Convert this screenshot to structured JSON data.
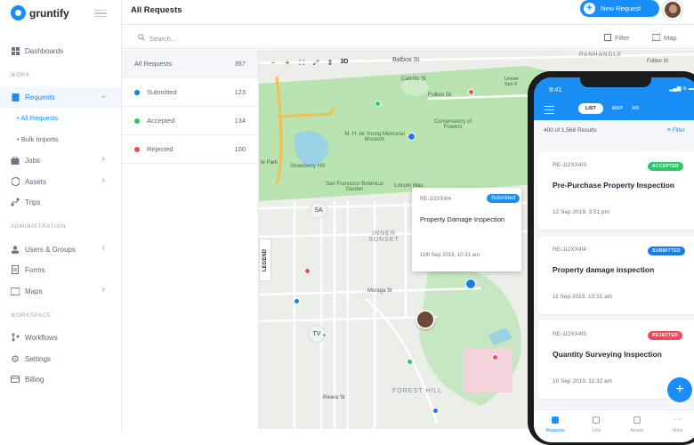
{
  "app": {
    "name": "gruntify",
    "page_title": "All Requests",
    "new_button": "New Request"
  },
  "sidebar": {
    "dashboards": "Dashboards",
    "section_work": "WORK",
    "requests": "Requests",
    "all_requests": "All Requests",
    "bulk_imports": "Bulk Imports",
    "jobs": "Jobs",
    "assets": "Assets",
    "trips": "Trips",
    "section_admin": "ADMINISTRATION",
    "users_groups": "Users & Groups",
    "forms": "Forms",
    "maps": "Maps",
    "section_workspace": "WORKSPACE",
    "workflows": "Workflows",
    "settings": "Settings",
    "billing": "Billing"
  },
  "toolbar": {
    "search_placeholder": "Search...",
    "filter": "Filter",
    "map": "Map"
  },
  "statuses": [
    {
      "label": "All Requests",
      "count": "357"
    },
    {
      "label": "Submitted",
      "count": "123",
      "color": "#1a7af0"
    },
    {
      "label": "Accepted",
      "count": "134",
      "color": "#2ec66b"
    },
    {
      "label": "Rejected",
      "count": "100",
      "color": "#ef4a5b"
    }
  ],
  "map": {
    "controls": [
      "−",
      "+",
      "⛶",
      "⤢",
      "⇕",
      "3D"
    ],
    "legend": "LEGEND",
    "clusters": [
      "SA",
      "TV"
    ],
    "labels": {
      "balboa": "Balboa St",
      "cabrillo": "Cabrillo St",
      "fulton": "Fulton St",
      "fulton_right": "Fulton St",
      "panhandle": "PANHANDLE",
      "conservatory": "Conservatory of Flowers",
      "deyoung": "M. H. de Young Memorial Museum",
      "strawberry": "Strawberry Hill",
      "botanical": "San Francisco Botanical Garden",
      "inner_sunset": "INNER SUNSET",
      "forest_hill": "FOREST HILL",
      "moraga": "Moraga St",
      "rivera": "Rivera St",
      "park": "te Park",
      "lincoln": "Lincoln Way",
      "univ": "Univer San F"
    },
    "popup": {
      "id": "RE-1I2XX4I4",
      "badge": "Submitted",
      "title": "Property Damage Inspection",
      "date": "11th Sep 2019, 10:31 am"
    }
  },
  "phone": {
    "time": "9:41",
    "status_icons": "▂▄▆ ≋ ▬",
    "tabs": [
      "LIST",
      "MAP",
      "AR"
    ],
    "results": "400 of 1,568 Results",
    "filter": "Filter",
    "cards": [
      {
        "id": "RE-1I2XX4I3",
        "badge": "ACCEPTED",
        "badge_color": "#2ec66b",
        "title": "Pre-Purchase Property Inspection",
        "date": "12 Sep 2019, 3:51 pm"
      },
      {
        "id": "RE-1I2XX4I4",
        "badge": "SUBMITTED",
        "badge_color": "#1a7af0",
        "title": "Property damage inspection",
        "date": "11 Sep 2019, 10:31 am"
      },
      {
        "id": "RE-1I2XX4I5",
        "badge": "REJECTED",
        "badge_color": "#ef4a5b",
        "title": "Quantity Surveying Inspection",
        "date": "10 Sep 2019, 11:32 am"
      }
    ],
    "bottom_tabs": [
      "Requests",
      "Jobs",
      "Assets",
      "More"
    ]
  }
}
